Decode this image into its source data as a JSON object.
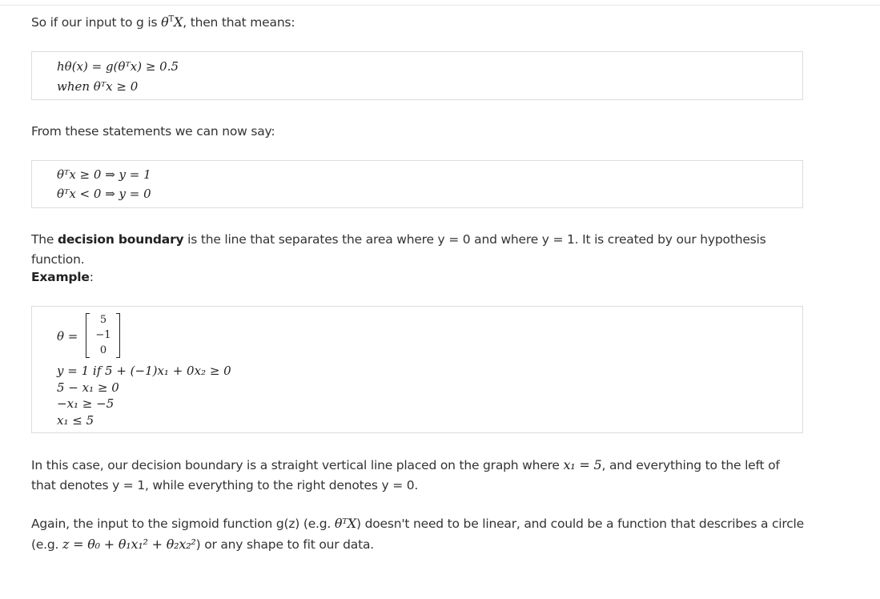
{
  "intro": {
    "text_before": "So if our input to g is ",
    "text_after": ", then that means:"
  },
  "box1": {
    "line1": "hθ(x) = g(θᵀx) ≥ 0.5",
    "line2": "when θᵀx ≥ 0"
  },
  "statements": {
    "text": "From these statements we can now say:"
  },
  "box2": {
    "line1": "θᵀx ≥ 0 ⇒ y = 1",
    "line2": "θᵀx < 0 ⇒ y = 0"
  },
  "boundary": {
    "prefix": "The ",
    "bold": "decision boundary",
    "rest": " is the line that separates the area where y = 0 and where y = 1. It is created by our hypothesis function."
  },
  "example": {
    "label": "Example",
    "colon": ":"
  },
  "box3": {
    "theta_label": "θ =",
    "matrix": [
      "5",
      "−1",
      "0"
    ],
    "line1": "y = 1 if 5 + (−1)x₁ + 0x₂ ≥ 0",
    "line2": "5 − x₁ ≥ 0",
    "line3": "−x₁ ≥ −5",
    "line4": "x₁ ≤ 5"
  },
  "case": {
    "part1": "In this case, our decision boundary is a straight vertical line placed on the graph where ",
    "math": "x₁ = 5",
    "part2": ", and everything to the left of that denotes y = 1, while everything to the right denotes y = 0."
  },
  "again": {
    "part1": "Again, the input to the sigmoid function g(z) (e.g. ",
    "math1": "θᵀX",
    "part2": ") doesn't need to be linear, and could be a function that describes a circle (e.g. ",
    "math2": "z = θ₀ + θ₁x₁² + θ₂x₂²",
    "part3": ") or any shape to fit our data."
  }
}
